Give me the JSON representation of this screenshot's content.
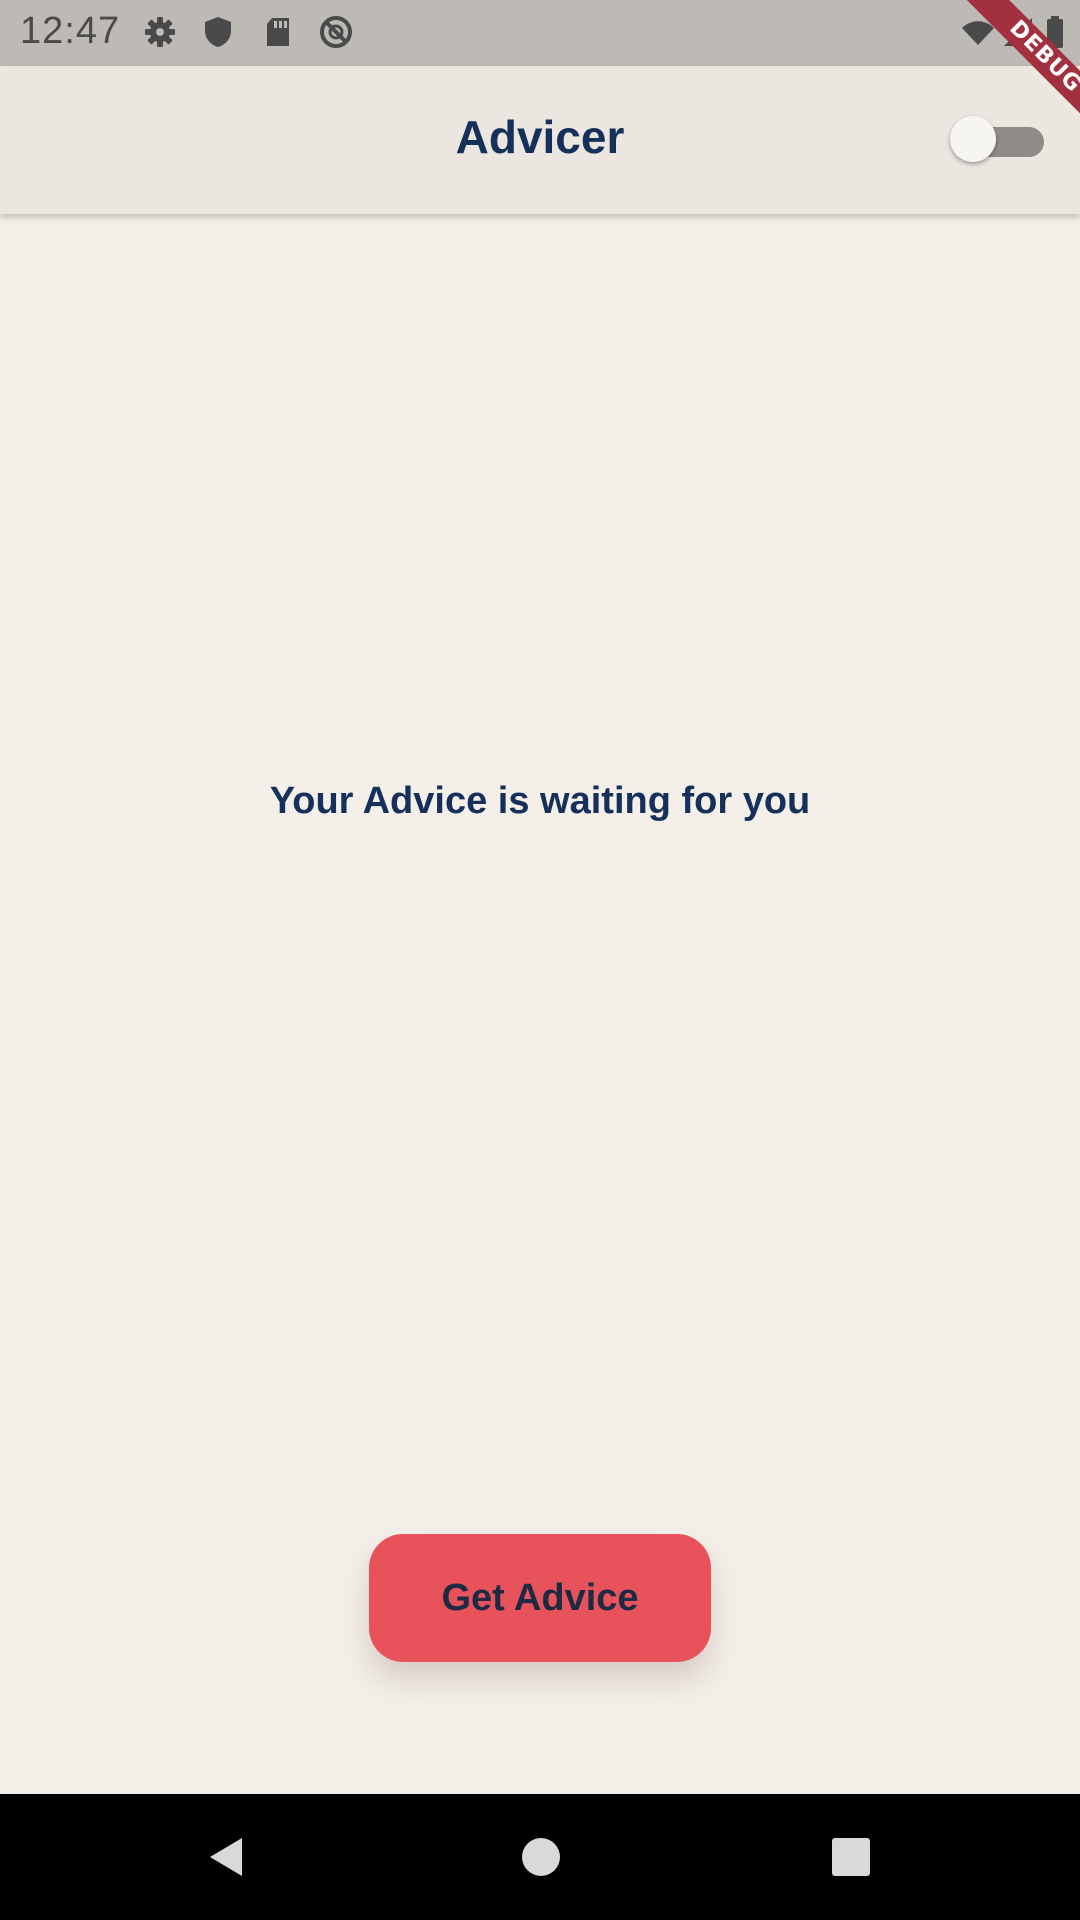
{
  "status_bar": {
    "time": "12:47",
    "icons": [
      "settings-icon",
      "shield-icon",
      "sd-card-icon",
      "do-not-disturb-icon",
      "wifi-icon",
      "signal-icon",
      "battery-icon"
    ]
  },
  "debug_banner": {
    "label": "DEBUG"
  },
  "app_bar": {
    "title": "Advicer",
    "theme_switch_on": false
  },
  "main": {
    "placeholder_text": "Your Advice is waiting for you",
    "button_label": "Get Advice"
  },
  "nav_bar": {
    "buttons": [
      "back-icon",
      "home-icon",
      "recents-icon"
    ]
  },
  "colors": {
    "background": "#f4efe9",
    "app_bar": "#ebe6df",
    "title_text": "#15315b",
    "button": "#e8525a",
    "status_bar": "#bdb9b4",
    "nav_bar": "#000000"
  }
}
